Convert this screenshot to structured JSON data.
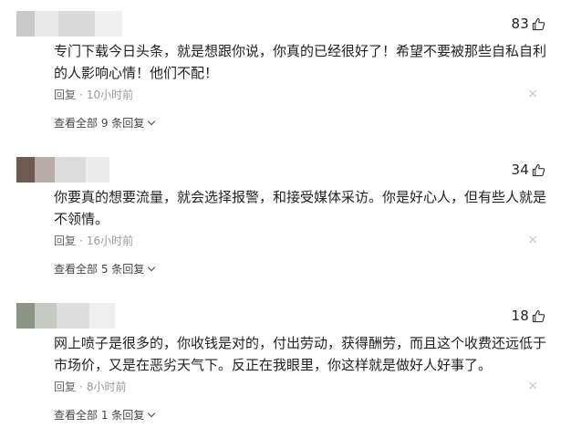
{
  "comments": [
    {
      "likes": "83",
      "text": "专门下载今日头条，就是想跟你说，你真的已经很好了！希望不要被那些自私自利的人影响心情！他们不配！",
      "reply_label": "回复",
      "separator": "·",
      "time": "10小时前",
      "close_symbol": "×",
      "view_all": "查看全部 9 条回复"
    },
    {
      "likes": "34",
      "text": "你要真的想要流量，就会选择报警，和接受媒体采访。你是好心人，但有些人就是不领情。",
      "reply_label": "回复",
      "separator": "·",
      "time": "16小时前",
      "close_symbol": "×",
      "view_all": "查看全部 5 条回复"
    },
    {
      "likes": "18",
      "text": "网上喷子是很多的，你收钱是对的，付出劳动，获得酬劳，而且这个收费还远低于市场价，又是在恶劣天气下。反正在我眼里，你这样就是做好人好事了。",
      "reply_label": "回复",
      "separator": "·",
      "time": "8小时前",
      "close_symbol": "×",
      "view_all": "查看全部 1 条回复"
    }
  ],
  "icons": {
    "like": "thumbs-up-icon",
    "close": "close-icon",
    "expand": "chevron-down-icon"
  },
  "colors": {
    "text": "#222222",
    "meta": "#999999",
    "reply": "#666666",
    "close": "#c8c8c8",
    "link": "#444444"
  }
}
